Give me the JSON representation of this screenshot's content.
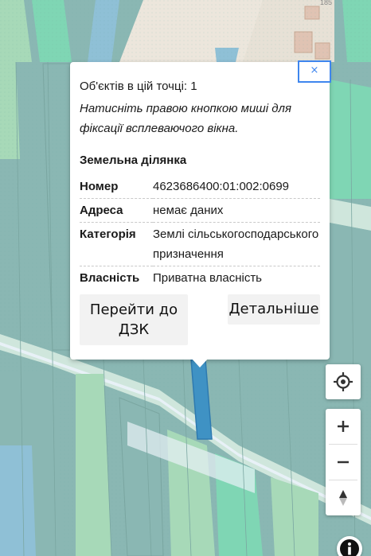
{
  "popup": {
    "close_glyph": "×",
    "objects_count_line": "Об'єктів в цій точці: 1",
    "hint": "Натисніть правою кнопкою миші для фіксації всплеваючого вікна.",
    "section_title": "Земельна ділянка",
    "attributes": [
      {
        "key": "Номер",
        "value": "4623686400:01:002:0699"
      },
      {
        "key": "Адреса",
        "value": "немає даних"
      },
      {
        "key": "Категорія",
        "value": "Землі сільськогосподарського призначення"
      },
      {
        "key": "Власність",
        "value": "Приватна власність"
      }
    ],
    "goto_dzk_label": "Перейти до ДЗК",
    "details_label": "Детальніше"
  },
  "map": {
    "house_number": "185",
    "colors": {
      "parcel_teal": "#8ab7b3",
      "parcel_green": "#a7d9b8",
      "parcel_mint": "#7fd6b4",
      "parcel_blue": "#8fc0d6",
      "road_light": "#cfe6dc",
      "selected_parcel": "#3f92c4",
      "building": "#e0c3b3",
      "urban": "#ece6dc"
    }
  },
  "controls": {
    "locate_icon": "crosshair-icon",
    "zoom_in_icon": "plus-icon",
    "zoom_out_icon": "minus-icon",
    "compass_icon": "compass-north-icon",
    "info_icon": "info-icon"
  }
}
